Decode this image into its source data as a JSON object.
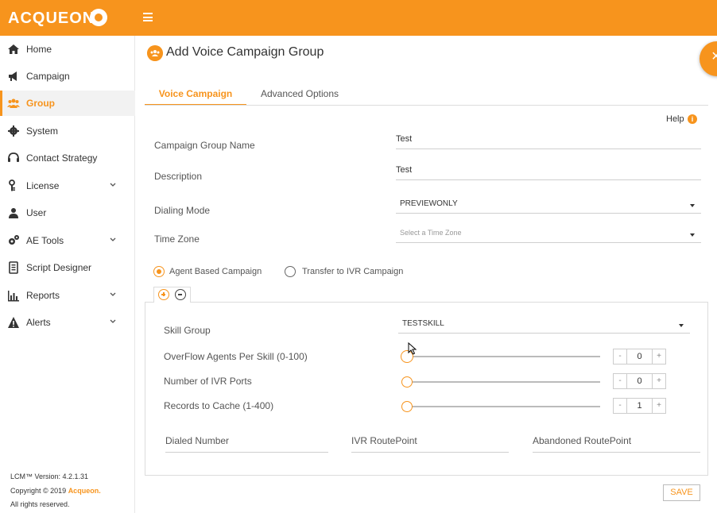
{
  "brand": {
    "logo_text": "ACQUEON",
    "accent": "#f7941d"
  },
  "sidebar": {
    "items": [
      {
        "label": "Home",
        "icon": "home-icon"
      },
      {
        "label": "Campaign",
        "icon": "megaphone-icon"
      },
      {
        "label": "Group",
        "icon": "group-icon",
        "active": true
      },
      {
        "label": "System",
        "icon": "gear-icon"
      },
      {
        "label": "Contact Strategy",
        "icon": "headset-icon"
      },
      {
        "label": "License",
        "icon": "key-icon",
        "expandable": true
      },
      {
        "label": "User",
        "icon": "user-icon"
      },
      {
        "label": "AE Tools",
        "icon": "cogs-icon",
        "expandable": true
      },
      {
        "label": "Script Designer",
        "icon": "document-icon"
      },
      {
        "label": "Reports",
        "icon": "bar-chart-icon",
        "expandable": true
      },
      {
        "label": "Alerts",
        "icon": "warning-icon",
        "expandable": true
      }
    ],
    "version": "LCM™ Version: 4.2.1.31",
    "copyright_prefix": "Copyright © 2019",
    "copyright_brand": "Acqueon.",
    "rights": "All rights reserved."
  },
  "page": {
    "title": "Add Voice Campaign Group",
    "tabs": [
      {
        "label": "Voice Campaign",
        "active": true
      },
      {
        "label": "Advanced Options"
      }
    ],
    "help_label": "Help",
    "help_icon_glyph": "i"
  },
  "form": {
    "campaign_group_name": {
      "label": "Campaign Group Name",
      "value": "Test"
    },
    "description": {
      "label": "Description",
      "value": "Test"
    },
    "dialing_mode": {
      "label": "Dialing Mode",
      "value": "PREVIEWONLY"
    },
    "time_zone": {
      "label": "Time Zone",
      "placeholder": "Select a Time Zone"
    },
    "campaign_type": {
      "options": [
        "Agent Based Campaign",
        "Transfer to IVR Campaign"
      ],
      "selected": "Agent Based Campaign"
    }
  },
  "skill_panel": {
    "skill_group": {
      "label": "Skill Group",
      "value": "TESTSKILL"
    },
    "sliders": [
      {
        "label": "OverFlow Agents Per Skill (0-100)",
        "value": "0",
        "minus": "-",
        "plus": "+"
      },
      {
        "label": "Number of IVR Ports",
        "value": "0",
        "minus": "-",
        "plus": "+"
      },
      {
        "label": "Records to Cache (1-400)",
        "value": "1",
        "minus": "-",
        "plus": "+"
      }
    ],
    "route_fields": [
      "Dialed Number",
      "IVR RoutePoint",
      "Abandoned RoutePoint"
    ]
  },
  "actions": {
    "save_label": "SAVE"
  }
}
